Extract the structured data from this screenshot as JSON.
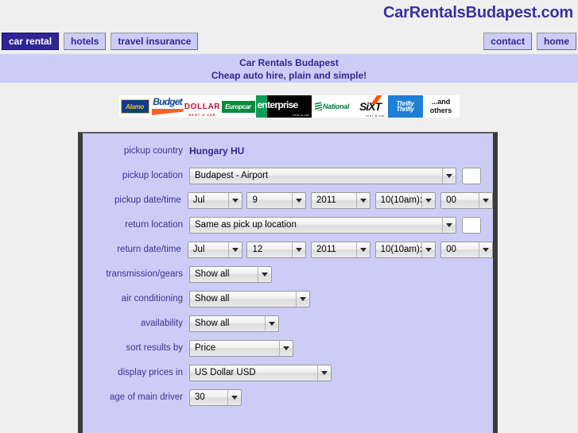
{
  "header": {
    "site_title": "CarRentalsBudapest.com"
  },
  "nav": {
    "left_items": [
      {
        "label": "car rental",
        "active": true
      },
      {
        "label": "hotels",
        "active": false
      },
      {
        "label": "travel insurance",
        "active": false
      }
    ],
    "right_items": [
      {
        "label": "contact"
      },
      {
        "label": "home"
      }
    ]
  },
  "banner": {
    "line1": "Car Rentals Budapest",
    "line2": "Cheap auto hire, plain and simple!"
  },
  "logos": [
    {
      "name": "alamo-logo",
      "text": "Alamo"
    },
    {
      "name": "budget-logo",
      "text": "Budget"
    },
    {
      "name": "dollar-logo",
      "text": "DOLLAR",
      "sub": "RENT A CAR"
    },
    {
      "name": "europcar-logo",
      "text": "Europcar"
    },
    {
      "name": "enterprise-logo",
      "text": "enterprise",
      "sub": "rent-a-car"
    },
    {
      "name": "national-logo",
      "text": "National"
    },
    {
      "name": "sixt-logo",
      "text": "SiXT",
      "sub": "rent a car"
    },
    {
      "name": "thrifty-logo",
      "text1": "Thrifty",
      "text2": "Thrifty"
    },
    {
      "name": "and-others-label",
      "line1": "...and",
      "line2": "others"
    }
  ],
  "form": {
    "pickup_country": {
      "label": "pickup country",
      "value": "Hungary HU"
    },
    "pickup_location": {
      "label": "pickup location",
      "value": "Budapest - Airport",
      "code_value": ""
    },
    "pickup_datetime": {
      "label": "pickup date/time",
      "month": "Jul",
      "day": "9",
      "year": "2011",
      "hour": "10(10am):",
      "minute": "00"
    },
    "return_location": {
      "label": "return location",
      "value": "Same as pick up location",
      "code_value": ""
    },
    "return_datetime": {
      "label": "return date/time",
      "month": "Jul",
      "day": "12",
      "year": "2011",
      "hour": "10(10am):",
      "minute": "00"
    },
    "transmission": {
      "label": "transmission/gears",
      "value": "Show all"
    },
    "air_conditioning": {
      "label": "air conditioning",
      "value": "Show all"
    },
    "availability": {
      "label": "availability",
      "value": "Show all"
    },
    "sort_results": {
      "label": "sort results by",
      "value": "Price"
    },
    "display_prices": {
      "label": "display prices in",
      "value": "US Dollar USD"
    },
    "driver_age": {
      "label": "age of main driver",
      "value": "30"
    }
  },
  "colors": {
    "brand_purple": "#2f2a8c",
    "banner_bg": "#ccccf7",
    "active_tab_bg": "#2e2694",
    "page_bg": "#efefef"
  }
}
